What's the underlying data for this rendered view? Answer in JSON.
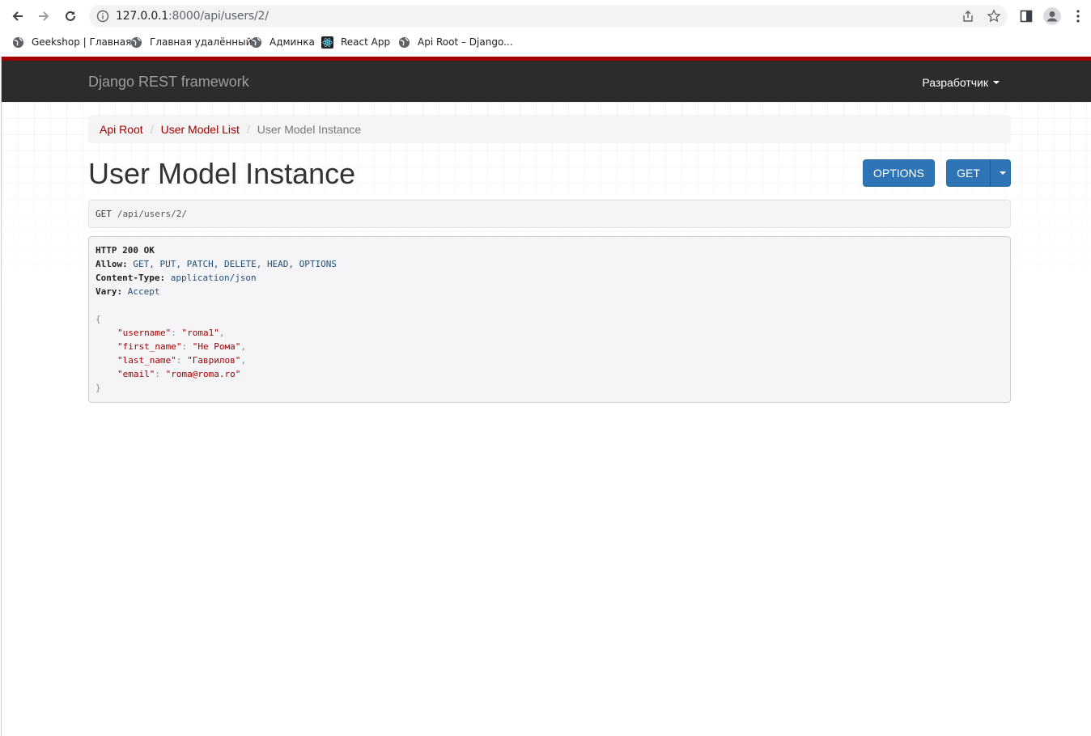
{
  "browser": {
    "url_host": "127.0.0.1",
    "url_rest": ":8000/api/users/2/",
    "bookmarks": [
      {
        "label": "Geekshop | Главная",
        "icon": "globe-icon"
      },
      {
        "label": "Главная удалённый",
        "icon": "globe-icon"
      },
      {
        "label": "Админка",
        "icon": "globe-icon"
      },
      {
        "label": "React App",
        "icon": "react-icon"
      },
      {
        "label": "Api Root – Django...",
        "icon": "globe-icon"
      }
    ]
  },
  "navbar": {
    "brand": "Django REST framework",
    "user_menu": "Разработчик"
  },
  "breadcrumb": {
    "items": [
      "Api Root",
      "User Model List"
    ],
    "separator": "/",
    "active": "User Model Instance"
  },
  "page": {
    "title": "User Model Instance",
    "options_button": "OPTIONS",
    "get_button": "GET"
  },
  "request": {
    "method": "GET",
    "path": "/api/users/2/"
  },
  "response": {
    "status": "HTTP 200 OK",
    "headers": [
      {
        "name": "Allow:",
        "value": "GET, PUT, PATCH, DELETE, HEAD, OPTIONS"
      },
      {
        "name": "Content-Type:",
        "value": "application/json"
      },
      {
        "name": "Vary:",
        "value": "Accept"
      }
    ],
    "open_brace": "{",
    "close_brace": "}",
    "fields": [
      {
        "key": "\"username\"",
        "value": "\"roma1\"",
        "comma": ","
      },
      {
        "key": "\"first_name\"",
        "value": "\"Не Рома\"",
        "comma": ","
      },
      {
        "key": "\"last_name\"",
        "value": "\"Гаврилов\"",
        "comma": ","
      },
      {
        "key": "\"email\"",
        "value": "\"roma@roma.ro\"",
        "comma": ""
      }
    ]
  },
  "colors": {
    "accent": "#a30000",
    "navbar_bg": "#2c2c2c",
    "button_primary": "#2f75b5"
  }
}
